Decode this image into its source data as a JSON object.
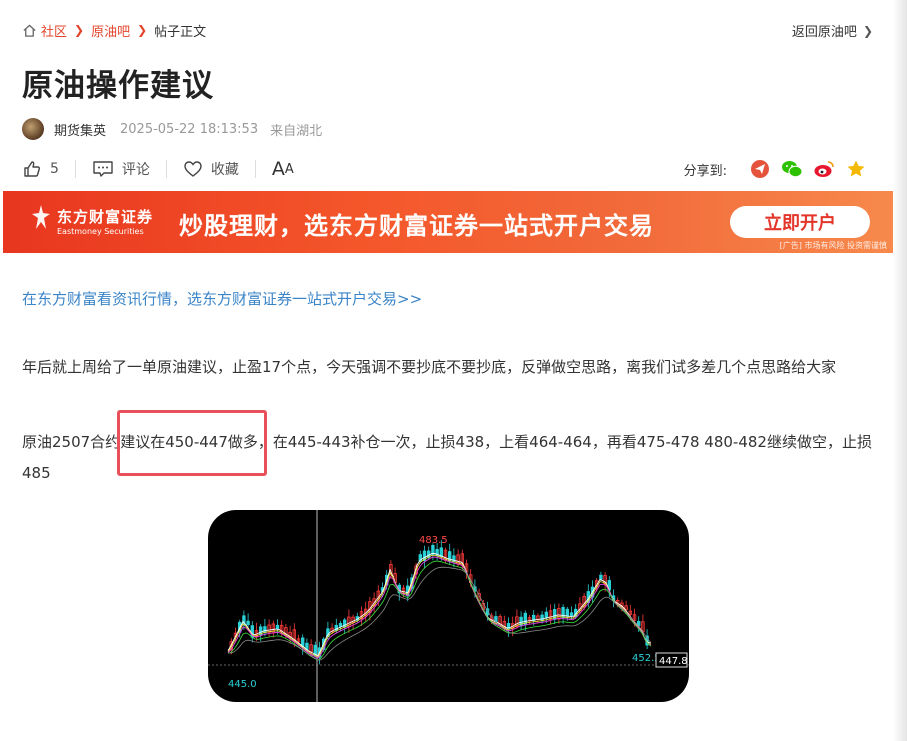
{
  "breadcrumb": {
    "home_icon": "home-icon",
    "items": [
      "社区",
      "原油吧",
      "帖子正文"
    ]
  },
  "back_link": "返回原油吧",
  "title": "原油操作建议",
  "meta": {
    "author": "期货集英",
    "time": "2025-05-22 18:13:53",
    "location": "来自湖北"
  },
  "actions": {
    "like_count": "5",
    "comment_label": "评论",
    "favorite_label": "收藏",
    "font_big": "A",
    "font_small": "A"
  },
  "share": {
    "label": "分享到:",
    "targets": [
      "paper-plane-icon",
      "wechat-icon",
      "weibo-icon",
      "star-icon"
    ]
  },
  "banner": {
    "logo_cn": "东方财富证券",
    "logo_en": "Eastmoney Securities",
    "slogan": "炒股理财，选东方财富证券一站式开户交易",
    "cta": "立即开户",
    "ad_note": "[广告] 市场有风险 投资需谨慎"
  },
  "content": {
    "ad_link": "在东方财富看资讯行情，选东方财富证券一站式开户交易>>",
    "p1": "年后就上周给了一单原油建议，止盈17个点，今天强调不要抄底不要抄底，反弹做空思路，离我们试多差几个点思路给大家",
    "p2_before": "原油2507合约",
    "p2_highlight": "建议在450-447做多",
    "p2_after": "，在445-443补仓一次，止损438，上看464-464，再看475-478  480-482继续做空，止损485"
  },
  "chart_labels": {
    "high": "483.5",
    "low": "445.0",
    "last": "452.5",
    "price_tag": "447.8"
  },
  "colors": {
    "accent": "#e3442b",
    "link": "#3a84c8",
    "highlight_border": "#e8505b",
    "up_candle": "#ff3b3b",
    "down_candle": "#29d0d6"
  }
}
